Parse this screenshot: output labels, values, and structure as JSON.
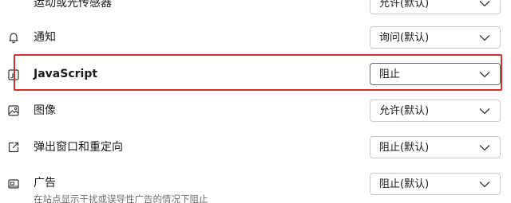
{
  "settings": [
    {
      "label": "运动或光传感器",
      "value": "允许(默认)",
      "icon": "sensor-icon"
    },
    {
      "label": "通知",
      "value": "询问(默认)",
      "icon": "bell-icon"
    },
    {
      "label": "JavaScript",
      "value": "阻止",
      "icon": "javascript-icon"
    },
    {
      "label": "图像",
      "value": "允许(默认)",
      "icon": "image-icon"
    },
    {
      "label": "弹出窗口和重定向",
      "value": "阻止(默认)",
      "icon": "popup-icon"
    },
    {
      "label": "广告",
      "value": "阻止(默认)",
      "sublabel": "在站点显示干扰或误导性广告的情况下阻止",
      "icon": "ads-icon"
    }
  ],
  "colors": {
    "highlight": "#d0302e",
    "border": "#c8c8c8"
  }
}
